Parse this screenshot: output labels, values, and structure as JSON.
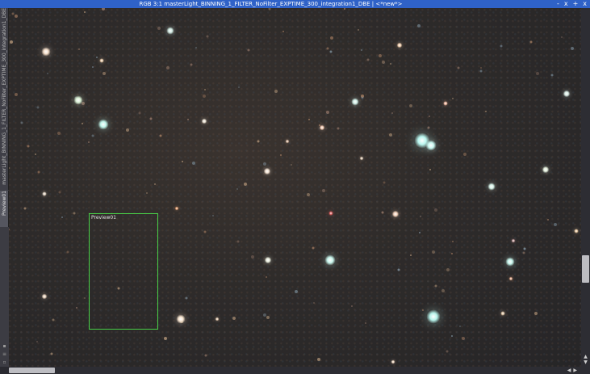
{
  "window": {
    "title": "RGB 3:1 masterLight_BINNING_1_FILTER_NoFilter_EXPTIME_300_integration1_DBE | <*new*>",
    "controls": [
      "-",
      "x",
      "+",
      "x"
    ]
  },
  "side_tabs": {
    "main": "masterLight_BINNING_1_FILTER_NoFilter_EXPTIME_300_integration1_DBE",
    "preview": "Preview01"
  },
  "preview": {
    "label": "Preview01"
  },
  "colors": {
    "titlebar": "#2f62c8",
    "preview_border": "#48d048"
  }
}
